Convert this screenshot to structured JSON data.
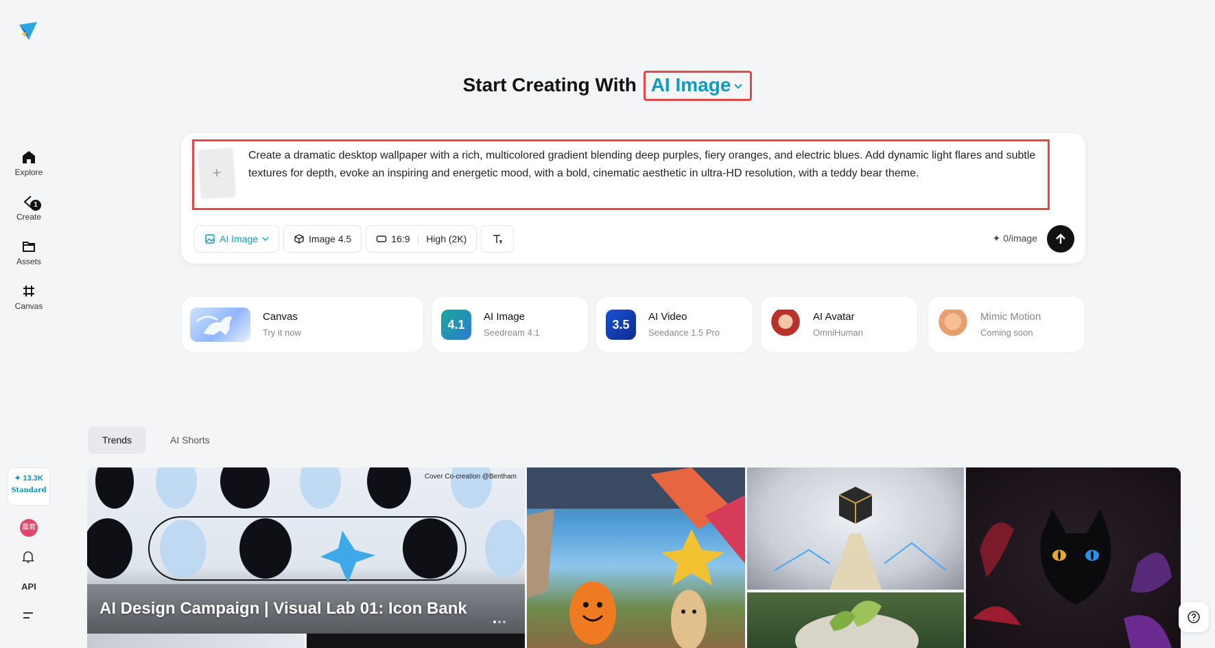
{
  "sidebar": {
    "items": [
      {
        "label": "Explore",
        "icon": "home-icon"
      },
      {
        "label": "Create",
        "icon": "create-icon",
        "badge": "1"
      },
      {
        "label": "Assets",
        "icon": "folder-icon"
      },
      {
        "label": "Canvas",
        "icon": "canvas-icon"
      }
    ],
    "credits": {
      "amount": "13.3K",
      "tier": "Standard"
    },
    "avatar_text": "震君",
    "api_label": "API"
  },
  "heading": {
    "prefix": "Start Creating With",
    "model": "AI Image"
  },
  "prompt": {
    "text": "Create a dramatic desktop wallpaper with a rich, multicolored gradient blending deep purples, fiery oranges, and electric blues. Add dynamic light flares and subtle textures for depth, evoke an inspiring and energetic mood, with a bold, cinematic aesthetic in ultra-HD resolution, with a teddy bear theme.",
    "upload_symbol": "+"
  },
  "toolbar": {
    "mode": "AI Image",
    "model": "Image 4.5",
    "ratio": "16:9",
    "quality": "High (2K)",
    "cost": "0/image"
  },
  "features": [
    {
      "title": "Canvas",
      "sub": "Try it now"
    },
    {
      "title": "AI Image",
      "sub": "Seedream 4.1",
      "thumb_text": "4.1"
    },
    {
      "title": "AI Video",
      "sub": "Seedance 1.5 Pro",
      "thumb_text": "3.5"
    },
    {
      "title": "AI Avatar",
      "sub": "OmniHuman"
    },
    {
      "title": "Mimic Motion",
      "sub": "Coming soon"
    }
  ],
  "tabs": [
    "Trends",
    "AI Shorts"
  ],
  "gallery": {
    "cover_credit": "Cover Co-creation @Bentham",
    "cover_title": "AI Design Campaign | Visual Lab 01: Icon Bank"
  },
  "colors": {
    "accent": "#0d9bbf",
    "highlight_border": "#e54646",
    "send_button": "#111111"
  }
}
